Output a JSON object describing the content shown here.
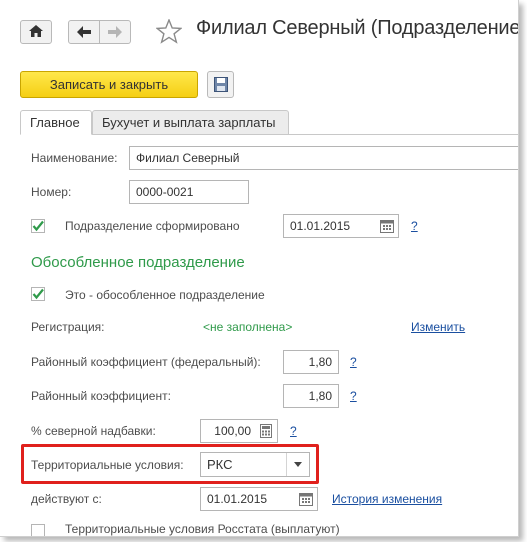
{
  "window": {
    "title": "Филиал Северный (Подразделение)"
  },
  "toolbar": {
    "save_close_label": "Записать и закрыть"
  },
  "tabs": [
    {
      "label": "Главное",
      "active": true
    },
    {
      "label": "Бухучет и выплата зарплаты",
      "active": false
    }
  ],
  "form": {
    "name_label": "Наименование:",
    "name_value": "Филиал Северный",
    "number_label": "Номер:",
    "number_value": "0000-0021",
    "formed_label": "Подразделение сформировано",
    "formed_checked": true,
    "formed_date": "01.01.2015",
    "help": "?",
    "section_title": "Обособленное подразделение",
    "separate_label": "Это - обособленное подразделение",
    "separate_checked": true,
    "registration_label": "Регистрация:",
    "registration_value": "<не заполнена>",
    "registration_link": "Изменить",
    "coef_fed_label": "Районный коэффициент (федеральный):",
    "coef_fed_value": "1,80",
    "coef_label": "Районный коэффициент:",
    "coef_value": "1,80",
    "north_label": "% северной надбавки:",
    "north_value": "100,00",
    "terr_label": "Территориальные условия:",
    "terr_value": "РКС",
    "valid_label": "действуют с:",
    "valid_date": "01.01.2015",
    "history_link": "История изменения",
    "cut_off_text": "Территориальные условия Росстата (выплатуют)"
  },
  "colors": {
    "accent_yellow": "#f5cf14",
    "section_green": "#2f9a4a",
    "link_blue": "#1a4fa0",
    "highlight_red": "#e0201c"
  }
}
